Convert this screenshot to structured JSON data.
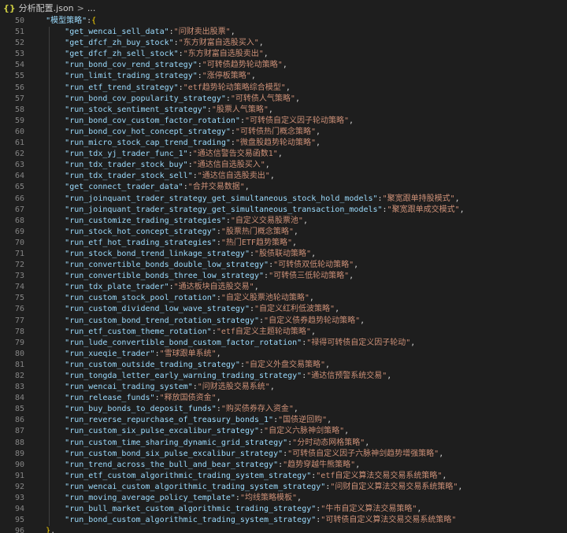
{
  "breadcrumb": {
    "file_icon": "{}",
    "file_name": "分析配置.json",
    "separator": ">",
    "more": "..."
  },
  "editor": {
    "group_key": "模型策略",
    "closing": "},",
    "lines": [
      {
        "n": 50,
        "k": "模型策略",
        "v": null,
        "type": "open"
      },
      {
        "n": 51,
        "k": "get_wencai_sell_data",
        "v": "问财卖出股票"
      },
      {
        "n": 52,
        "k": "get_dfcf_zh_buy_stock",
        "v": "东方财富自选股买入"
      },
      {
        "n": 53,
        "k": "get_dfcf_zh_sell_stock",
        "v": "东方财富自选股卖出"
      },
      {
        "n": 54,
        "k": "run_bond_cov_rend_strategy",
        "v": "可转债趋势轮动策略"
      },
      {
        "n": 55,
        "k": "run_limit_trading_strategy",
        "v": "涨停板策略"
      },
      {
        "n": 56,
        "k": "run_etf_trend_strategy",
        "v": "etf趋势轮动策略综合模型"
      },
      {
        "n": 57,
        "k": "run_bond_cov_popularity_strategy",
        "v": "可转债人气策略"
      },
      {
        "n": 58,
        "k": "run_stock_sentiment_strategy",
        "v": "股票人气策略"
      },
      {
        "n": 59,
        "k": "run_bond_cov_custom_factor_rotation",
        "v": "可转债自定义因子轮动策略"
      },
      {
        "n": 60,
        "k": "run_bond_cov_hot_concept_strategy",
        "v": "可转债热门概念策略"
      },
      {
        "n": 61,
        "k": "run_micro_stock_cap_trend_trading",
        "v": "微盘股趋势轮动策略"
      },
      {
        "n": 62,
        "k": "run_tdx_yj_trader_func_1",
        "v": "通达信警告交易函数1"
      },
      {
        "n": 63,
        "k": "run_tdx_trader_stock_buy",
        "v": "通达信自选股买入"
      },
      {
        "n": 64,
        "k": "run_tdx_trader_stock_sell",
        "v": "通达信自选股卖出"
      },
      {
        "n": 65,
        "k": "get_connect_trader_data",
        "v": "合并交易数据"
      },
      {
        "n": 66,
        "k": "run_joinquant_trader_strategy_get_simultaneous_stock_hold_models",
        "v": "聚宽跟单持股模式"
      },
      {
        "n": 67,
        "k": "run_joinquant_trader_strategy_get_simultaneous_transaction_models",
        "v": "聚宽跟单成交模式"
      },
      {
        "n": 68,
        "k": "run_customize_trading_strategies",
        "v": "自定义交易股票池"
      },
      {
        "n": 69,
        "k": "run_stock_hot_concept_strategy",
        "v": "股票热门概念策略"
      },
      {
        "n": 70,
        "k": "run_etf_hot_trading_strategies",
        "v": "热门ETF趋势策略"
      },
      {
        "n": 71,
        "k": "run_stock_bond_trend_linkage_strategy",
        "v": "股债联动策略"
      },
      {
        "n": 72,
        "k": "run_convertible_bonds_double_low_strategy",
        "v": "可转债双低轮动策略"
      },
      {
        "n": 73,
        "k": "run_convertible_bonds_three_low_strategy",
        "v": "可转债三低轮动策略"
      },
      {
        "n": 74,
        "k": "run_tdx_plate_trader",
        "v": "通达板块自选股交易"
      },
      {
        "n": 75,
        "k": "run_custom_stock_pool_rotation",
        "v": "自定义股票池轮动策略"
      },
      {
        "n": 76,
        "k": "run_custom_dividend_low_wave_strategy",
        "v": "自定义红利低波策略"
      },
      {
        "n": 77,
        "k": "run_custom_bond_trend_rotation_strategy",
        "v": "自定义债券趋势轮动策略"
      },
      {
        "n": 78,
        "k": "run_etf_custom_theme_rotation",
        "v": "etf自定义主题轮动策略"
      },
      {
        "n": 79,
        "k": "run_lude_convertible_bond_custom_factor_rotation",
        "v": "禄得可转债自定义因子轮动"
      },
      {
        "n": 80,
        "k": "run_xueqie_trader",
        "v": "雪球跟单系统"
      },
      {
        "n": 81,
        "k": "run_custom_outside_trading_strategy",
        "v": "自定义外盘交易策略"
      },
      {
        "n": 82,
        "k": "run_tongda_letter_early_warning_trading_strategy",
        "v": "通达信预警系统交易"
      },
      {
        "n": 83,
        "k": "run_wencai_trading_system",
        "v": "问财选股交易系统"
      },
      {
        "n": 84,
        "k": "run_release_funds",
        "v": "释放国债资金"
      },
      {
        "n": 85,
        "k": "run_buy_bonds_to_deposit_funds",
        "v": "购买债券存入资金"
      },
      {
        "n": 86,
        "k": "run_reverse_repurchase_of_treasury_bonds_1",
        "v": "国债逆回购"
      },
      {
        "n": 87,
        "k": "run_custom_six_pulse_excalibur_strategy",
        "v": "自定义六脉神剑策略"
      },
      {
        "n": 88,
        "k": "run_custom_time_sharing_dynamic_grid_strategy",
        "v": "分时动态网格策略"
      },
      {
        "n": 89,
        "k": "run_custom_bond_six_pulse_excalibur_strategy",
        "v": "可转债自定义因子六脉神剑趋势增强策略"
      },
      {
        "n": 90,
        "k": "run_trend_across_the_bull_and_bear_strategy",
        "v": "趋势穿越牛熊策略"
      },
      {
        "n": 91,
        "k": "run_etf_custom_algorithmic_trading_system_strategy",
        "v": "etf自定义算法交易交易系统策略"
      },
      {
        "n": 92,
        "k": "run_wencai_custom_algorithmic_trading_system_strategy",
        "v": "问财自定义算法交易交易系统策略"
      },
      {
        "n": 93,
        "k": "run_moving_average_policy_template",
        "v": "均线策略模板"
      },
      {
        "n": 94,
        "k": "run_bull_market_custom_algorithmic_trading_strategy",
        "v": "牛市自定义算法交易策略"
      },
      {
        "n": 95,
        "k": "run_bond_custom_algorithmic_trading_system_strategy",
        "v": "可转债自定义算法交易交易系统策略",
        "last": true
      },
      {
        "n": 96,
        "k": null,
        "v": null,
        "type": "close"
      }
    ]
  }
}
